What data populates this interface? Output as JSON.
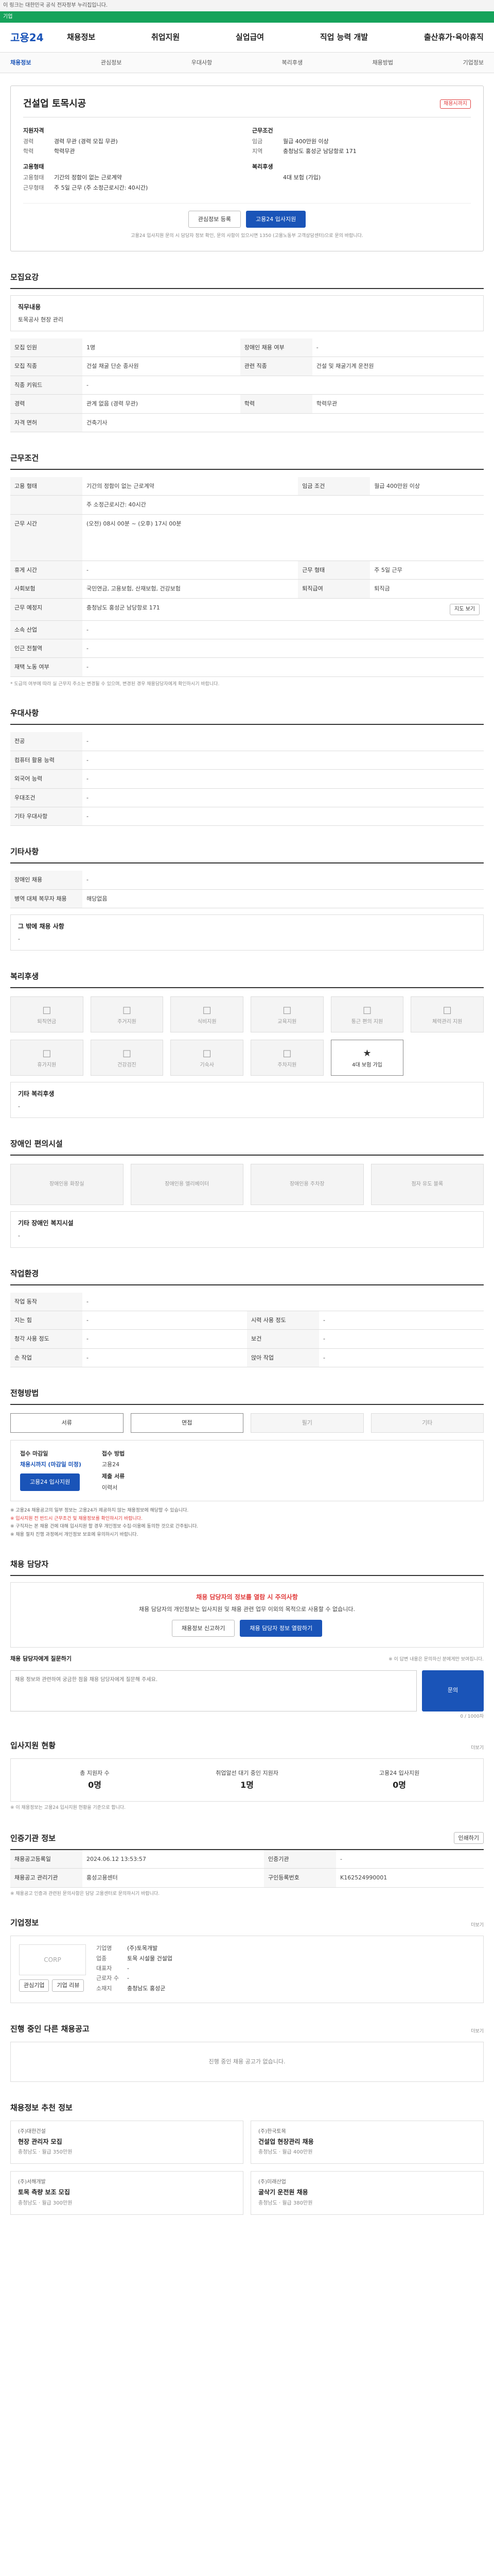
{
  "topbar": "이 링크는 대한민국 공식 전자정부 누리집입니다.",
  "greenbar": "기업",
  "logo": "고용24",
  "gnb": [
    "채용정보",
    "취업지원",
    "실업급여",
    "직업 능력 개발",
    "출산휴가·육아휴직"
  ],
  "subtabs": [
    "채용정보",
    "관심정보",
    "우대사항",
    "복리후생",
    "채용방법",
    "기업정보"
  ],
  "card": {
    "title": "건설업 토목시공",
    "badge": "채용시까지",
    "left": {
      "h": "지원자격",
      "rows": [
        [
          "경력",
          "경력 무관 (경력 모집 무관)"
        ],
        [
          "학력",
          "학력무관"
        ]
      ]
    },
    "right": {
      "h": "근무조건",
      "rows": [
        [
          "임금",
          "월급 400만원 이상"
        ],
        [
          "지역",
          "충청남도 홍성군 남당항로 171"
        ]
      ]
    },
    "left2": {
      "h": "고용형태",
      "rows": [
        [
          "고용형태",
          "기간의 정함이 없는 근로계약"
        ],
        [
          "근무형태",
          "주 5일 근무 (주 소정근로시간: 40시간)"
        ]
      ]
    },
    "right2": {
      "h": "복리후생",
      "rows": [
        [
          "",
          "4대 보험 (가입)"
        ]
      ]
    },
    "btn_fav": "관심정보 등록",
    "btn_apply": "고용24 입사지원",
    "note": "고용24 입사지원 문의 시 담당자 정보 확인, 문의 사항이 있으시면 1350 (고용노동부 고객상담센터)으로 문의 바랍니다."
  },
  "req": {
    "title": "모집요강",
    "job_label": "직무내용",
    "job_value": "토목공사 현장 관리",
    "rows": [
      [
        "모집 인원",
        "1명",
        "장애인 채용 여부",
        "-"
      ],
      [
        "모집 직종",
        "건설 채굴 단순 종사원",
        "관련 직종",
        "건설 및 채굴기계 운전원"
      ],
      [
        "직종 키워드",
        "-",
        "",
        ""
      ],
      [
        "경력",
        "관계 없음 (경력 무관)",
        "학력",
        "학력무관"
      ],
      [
        "자격 면허",
        "건축기사",
        "",
        ""
      ]
    ]
  },
  "cond": {
    "title": "근무조건",
    "rows": [
      [
        "고용 형태",
        "기간의 정함이 없는 근로계약",
        "임금 조건",
        "월급 400만원 이상"
      ],
      [
        "",
        "주 소정근로시간: 40시간",
        "",
        ""
      ],
      [
        "근무 시간",
        "(오전) 08시 00분 ~ (오후) 17시 00분",
        "",
        ""
      ],
      [
        "휴게 시간",
        "-",
        "근무 형태",
        "주 5일 근무"
      ],
      [
        "사회보험",
        "국민연금, 고용보험, 산재보험, 건강보험",
        "퇴직급여",
        "퇴직금"
      ],
      [
        "근무 예정지",
        "충청남도 홍성군 남당항로 171",
        "",
        ""
      ],
      [
        "소속 산업",
        "-",
        "",
        ""
      ],
      [
        "인근 전철역",
        "-",
        "",
        ""
      ],
      [
        "재택 노동 여부",
        "-",
        "",
        ""
      ]
    ],
    "map_btn": "지도 보기",
    "note": "* 도급의 여부에 따라 실 근무지 주소는 변경될 수 있으며, 변경된 경우 채용담당자에게 확인하시기 바랍니다."
  },
  "pref": {
    "title": "우대사항",
    "rows": [
      [
        "전공",
        "-"
      ],
      [
        "컴퓨터 활용 능력",
        "-"
      ],
      [
        "외국어 능력",
        "-"
      ],
      [
        "우대조건",
        "-"
      ],
      [
        "기타 우대사항",
        "-"
      ]
    ]
  },
  "etc": {
    "title": "기타사항",
    "rows": [
      [
        "장애인 채용",
        "-"
      ],
      [
        "병역 대체 복무자 채용",
        "해당없음"
      ]
    ],
    "box_h": "그 밖에 채용 사항",
    "box_v": "-"
  },
  "welfare": {
    "title": "복리후생",
    "items": [
      "퇴직연금",
      "주거지원",
      "식비지원",
      "교육지원",
      "통근 편의 지원",
      "체력관리 지원",
      "휴가지원",
      "건강검진",
      "기숙사",
      "주차지원",
      "4대 보험 가입"
    ],
    "active": 10,
    "icon": "★",
    "other_h": "기타 복리후생",
    "other_v": "-"
  },
  "disability": {
    "title": "장애인 편의시설",
    "items": [
      "장애인용 화장실",
      "장애인용 엘리베이터",
      "장애인용 주차장",
      "점자 유도 블록"
    ],
    "other_h": "기타 장애인 복지시설",
    "other_v": "-"
  },
  "work": {
    "title": "작업환경",
    "rows": [
      [
        "작업 동작",
        "-",
        "",
        ""
      ],
      [
        "지는 힘",
        "-",
        "시력 사용 정도",
        "-"
      ],
      [
        "청각 사용 정도",
        "-",
        "보건",
        "-"
      ],
      [
        "손 작업",
        "-",
        "앉아 작업",
        "-"
      ]
    ]
  },
  "method": {
    "title": "전형방법",
    "items": [
      "서류",
      "면접",
      "필기",
      "기타"
    ],
    "active": [
      0,
      1
    ],
    "h1": "접수 마감일",
    "v1": "채용시까지 (마감일 미정)",
    "h2": "접수 방법",
    "v2": "고용24",
    "h3": "제출 서류",
    "v3": "이력서",
    "apply_btn": "고용24 입사지원",
    "bullets": [
      "※ 고용24 채용공고의 일부 정보는 고용24가 제공하지 않는 채용정보에 해당할 수 있습니다.",
      "※ 입사지원 전 반드시 근무조건 및 채용정보를 확인하시기 바랍니다.",
      "※ 구직자는 본 채용 건에 대해 입사지원 할 경우 개인정보 수집·이용에 동의한 것으로 간주됩니다.",
      "※ 채용 절차 진행 과정에서 개인정보 보호에 유의하시기 바랍니다."
    ]
  },
  "contact": {
    "title": "채용 담당자",
    "warn": "채용 담당자의 정보를 열람 시 주의사항",
    "desc": "채용 담당자의 개인정보는 입사지원 및 채용 관련 업무 이외의 목적으로 사용할 수 없습니다.",
    "btn1": "채용정보 신고하기",
    "btn2": "채용 담당자 정보 열람하기",
    "inq_h": "채용 담당자에게 질문하기",
    "inq_placeholder": "채용 정보와 관련하여 궁금한 점을 채용 담당자에게 질문해 주세요.",
    "inq_btn": "문의",
    "inq_count": "0 / 1000자",
    "inq_note": "※ 이 답변 내용은 문의하신 분에게만 보여집니다."
  },
  "status": {
    "title": "입사지원 현황",
    "more": "더보기",
    "h": [
      "총 지원자 수",
      "취업알선 대기 중인 지원자",
      "고용24 입사지원"
    ],
    "v": [
      "0명",
      "1명",
      "0명"
    ],
    "note": "※ 이 채용정보는 고용24 입사지원 현황을 기준으로 합니다."
  },
  "info": {
    "title": "인증기관 정보",
    "rows": [
      [
        "채용공고등록일",
        "2024.06.12 13:53:57",
        "인증기관",
        "-"
      ],
      [
        "채용공고 관리기관",
        "홍성고용센터",
        "구인등록번호",
        "K162524990001"
      ]
    ],
    "btn": "인쇄하기",
    "note": "※ 채용공고 인증과 관련된 문의사항은 담당 고용센터로 문의하시기 바랍니다."
  },
  "company": {
    "title": "기업정보",
    "more": "더보기",
    "logo": "CORP",
    "rows": [
      [
        "기업명",
        "(주)토목개발"
      ],
      [
        "업종",
        "토목 시설물 건설업"
      ],
      [
        "대표자",
        "-"
      ],
      [
        "근로자 수",
        "-"
      ],
      [
        "소재지",
        "충청남도 홍성군"
      ]
    ],
    "btn1": "관심기업",
    "btn2": "기업 리뷰"
  },
  "others": {
    "title": "진행 중인 다른 채용공고",
    "more": "더보기",
    "empty": "진행 중인 채용 공고가 없습니다."
  },
  "recs": {
    "title": "채용정보 추천 정보",
    "items": [
      {
        "co": "(주)대한건설",
        "t": "현장 관리자 모집",
        "m": "충청남도 · 월급 350만원"
      },
      {
        "co": "(주)한국토목",
        "t": "건설업 현장관리 채용",
        "m": "충청남도 · 월급 400만원"
      },
      {
        "co": "(주)서해개발",
        "t": "토목 측량 보조 모집",
        "m": "충청남도 · 월급 300만원"
      },
      {
        "co": "(주)미래산업",
        "t": "굴삭기 운전원 채용",
        "m": "충청남도 · 월급 380만원"
      }
    ]
  }
}
